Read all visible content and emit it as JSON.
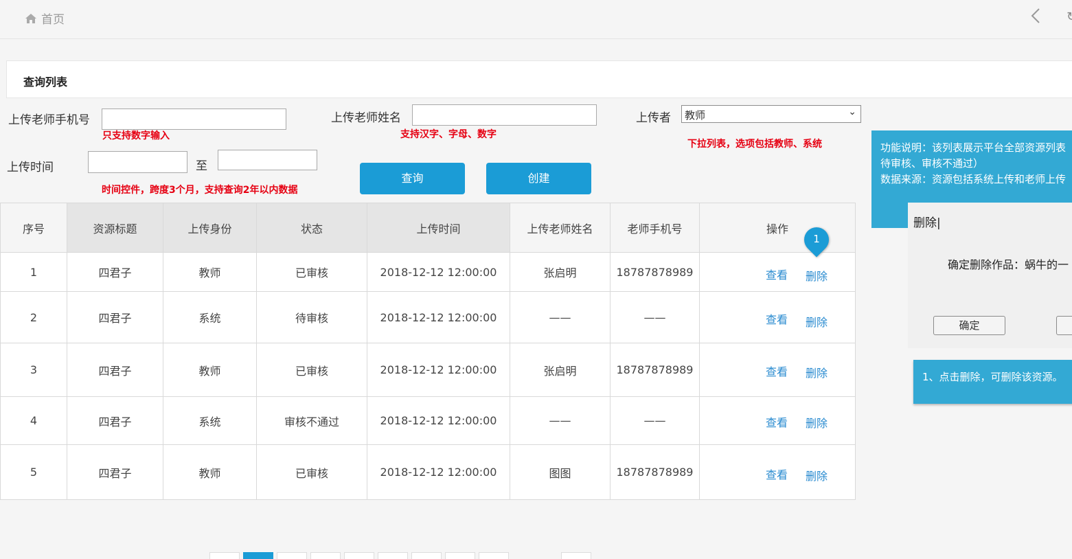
{
  "header": {
    "home_label": "首页",
    "home_icon": "home-icon",
    "back_icon": "chevron-left-icon",
    "refresh_icon": "refresh-icon"
  },
  "panel": {
    "title": "查询列表"
  },
  "filters": {
    "phone_label": "上传老师手机号",
    "phone_value": "",
    "phone_note": "只支持数字输入",
    "name_label": "上传老师姓名",
    "name_value": "",
    "name_note": "支持汉字、字母、数字",
    "uploader_label": "上传者",
    "uploader_selected": "教师",
    "uploader_note": "下拉列表，选项包括教师、系统",
    "time_label": "上传时间",
    "time_separator": "至",
    "time_start": "",
    "time_end": "",
    "time_note": "时间控件，跨度3个月，支持查询2年以内数据",
    "query_button": "查询",
    "create_button": "创建"
  },
  "table": {
    "columns": [
      "序号",
      "资源标题",
      "上传身份",
      "状态",
      "上传时间",
      "上传老师姓名",
      "老师手机号",
      "操作"
    ],
    "view_label": "查看",
    "delete_label": "删除",
    "rows": [
      [
        "1",
        "四君子",
        "教师",
        "已审核",
        "2018-12-12 12:00:00",
        "张启明",
        "18787878989"
      ],
      [
        "2",
        "四君子",
        "系统",
        "待审核",
        "2018-12-12 12:00:00",
        "——",
        "——"
      ],
      [
        "3",
        "四君子",
        "教师",
        "已审核",
        "2018-12-12 12:00:00",
        "张启明",
        "18787878989"
      ],
      [
        "4",
        "四君子",
        "系统",
        "审核不通过",
        "2018-12-12 12:00:00",
        "——",
        "——"
      ],
      [
        "5",
        "四君子",
        "教师",
        "已审核",
        "2018-12-12 12:00:00",
        "图图",
        "18787878989"
      ]
    ]
  },
  "annotation": {
    "marker_number": "1",
    "info_line1": "功能说明：该列表展示平台全部资源列表",
    "info_line2": "待审核、审核不通过）",
    "info_line3": "数据来源：资源包括系统上传和老师上传",
    "tip": "1、点击删除，可删除该资源。"
  },
  "dialog": {
    "title": "删除|",
    "message": "确定删除作品：蜗牛的一",
    "confirm_button": "确定",
    "cancel_button": ""
  },
  "colors": {
    "accent": "#1b9cd6",
    "note_red": "#e60012",
    "link": "#2a8bd0",
    "annotation_bg": "#33a9d4"
  }
}
